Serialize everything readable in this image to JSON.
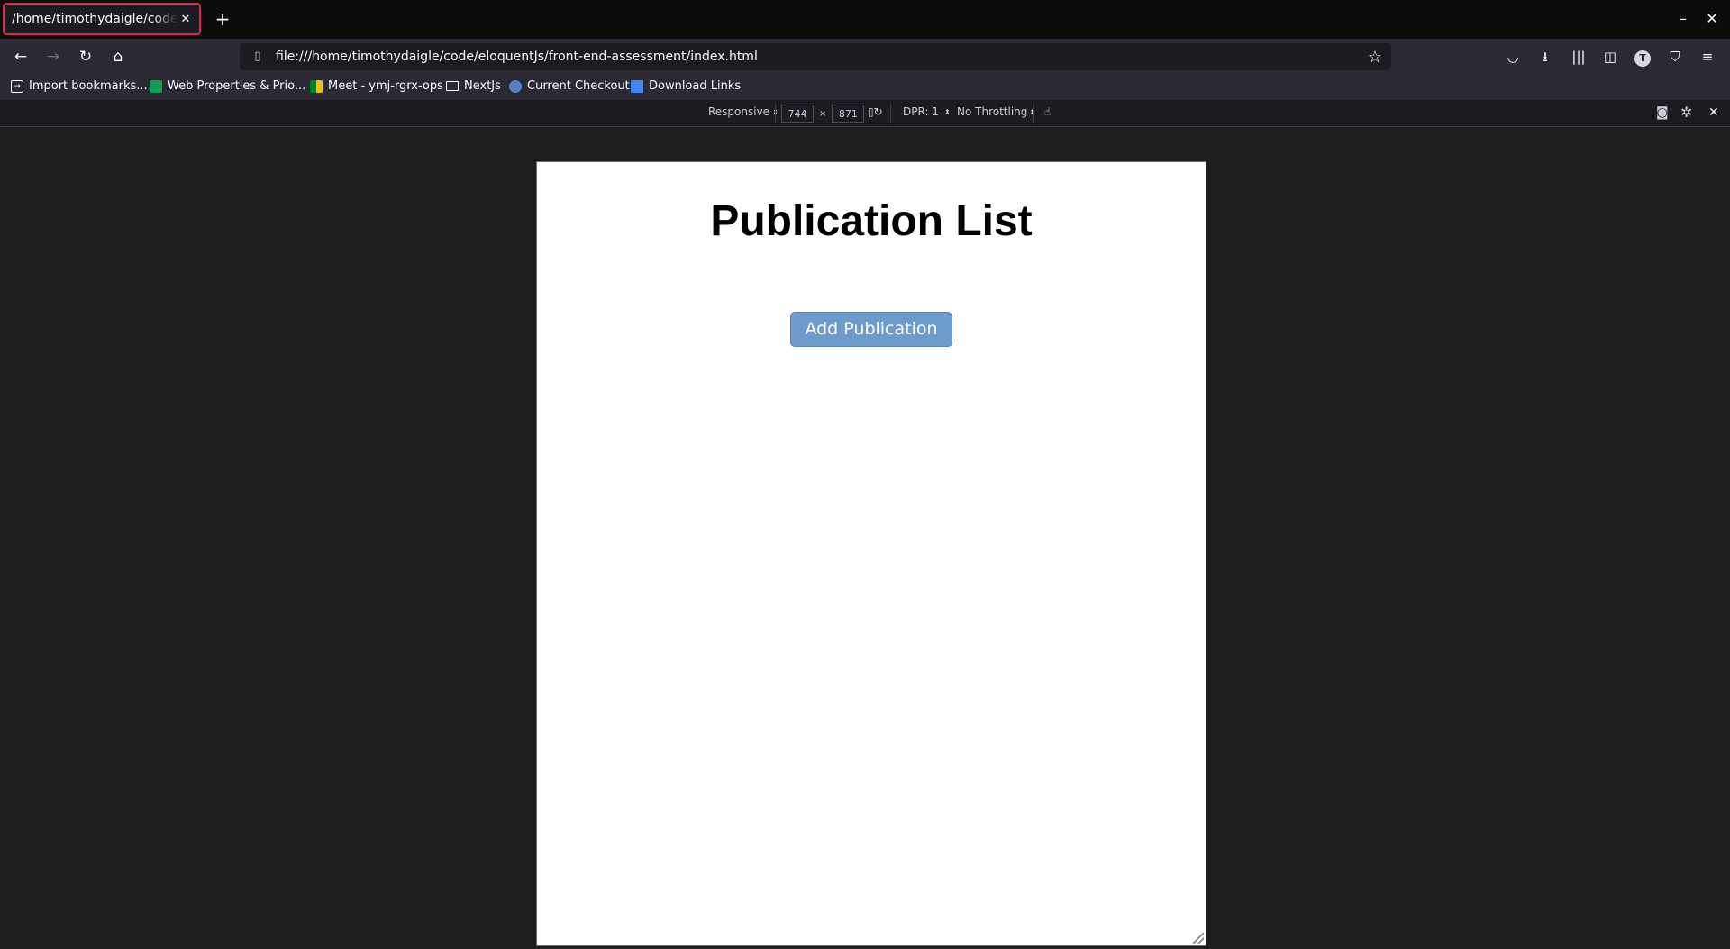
{
  "browser": {
    "tab": {
      "title": "/home/timothydaigle/code/eloquentJs/front-end-assessment/index.html",
      "close_icon": "close-icon"
    },
    "new_tab_label": "+",
    "window_controls": {
      "minimize": "–",
      "close": "✕"
    },
    "nav": {
      "back": "←",
      "forward": "→",
      "reload": "↻",
      "home": "⌂"
    },
    "url": "file:///home/timothydaigle/code/eloquentJs/front-end-assessment/index.html",
    "bookmarks": [
      {
        "label": "Import bookmarks...",
        "icon": "import-icon"
      },
      {
        "label": "Web Properties & Prio...",
        "icon": "sheets-icon"
      },
      {
        "label": "Meet - ymj-rgrx-ops",
        "icon": "meet-icon"
      },
      {
        "label": "NextJs",
        "icon": "folder-icon"
      },
      {
        "label": "Current Checkout",
        "icon": "checkout-icon"
      },
      {
        "label": "Download Links",
        "icon": "docs-icon"
      }
    ],
    "avatar_letter": "T"
  },
  "rdm": {
    "device": "Responsive",
    "width": "744",
    "height": "871",
    "times": "×",
    "dpr": "DPR: 1",
    "throttling": "No Throttling"
  },
  "page": {
    "title": "Publication List",
    "add_button": "Add Publication"
  }
}
